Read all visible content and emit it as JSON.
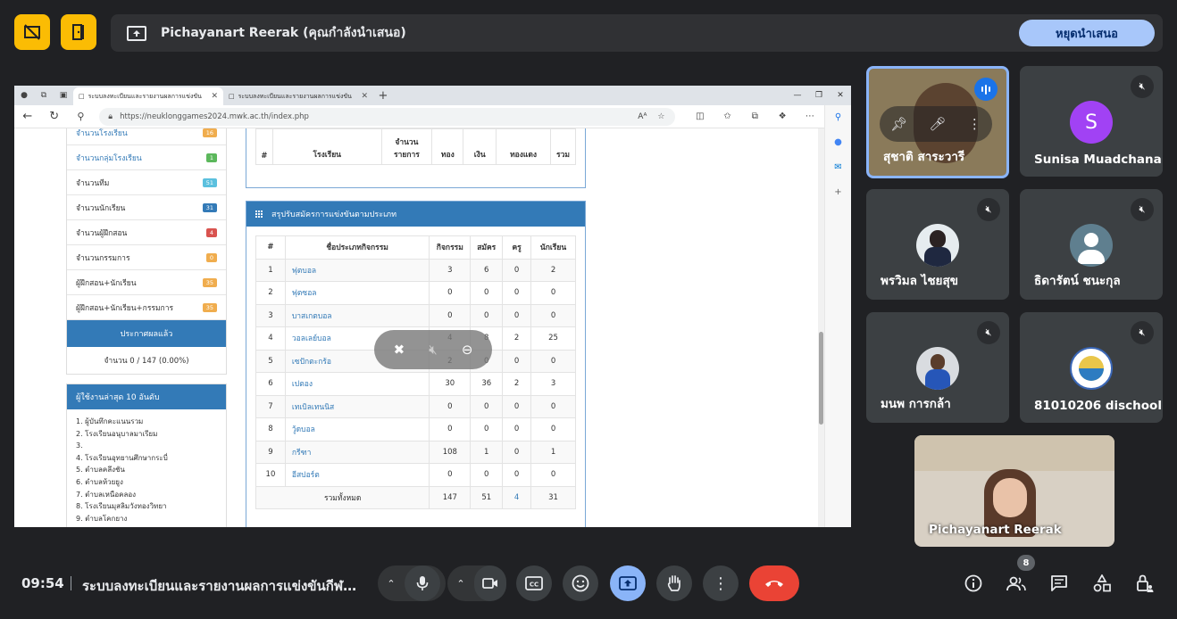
{
  "banner": {
    "presenter_title": "Pichayanart Reerak (คุณกำลังนำเสนอ)",
    "stop_label": "หยุดนำเสนอ"
  },
  "browser": {
    "tabs": [
      {
        "label": "ระบบลงทะเบียนและรายงานผลการแข่งขัน",
        "active": true
      },
      {
        "label": "ระบบลงทะเบียนและรายงานผลการแข่งขัน",
        "active": false
      }
    ],
    "url": "https://neuklonggames2024.mwk.ac.th/index.php",
    "reader_icon": "Aᴬ"
  },
  "left_panel": {
    "items": [
      {
        "label": "จำนวนโรงเรียน",
        "badge": "16",
        "color": "#f0ad4e",
        "link": true
      },
      {
        "label": "จำนวนกลุ่มโรงเรียน",
        "badge": "1",
        "color": "#5cb85c",
        "link": true
      },
      {
        "label": "จำนวนทีม",
        "badge": "51",
        "color": "#5bc0de",
        "link": false
      },
      {
        "label": "จำนวนนักเรียน",
        "badge": "31",
        "color": "#337ab7",
        "link": false
      },
      {
        "label": "จำนวนผู้ฝึกสอน",
        "badge": "4",
        "color": "#d9534f",
        "link": false
      },
      {
        "label": "จำนวนกรรมการ",
        "badge": "0",
        "color": "#f0ad4e",
        "link": false
      },
      {
        "label": "ผู้ฝึกสอน+นักเรียน",
        "badge": "35",
        "color": "#f0ad4e",
        "link": false
      },
      {
        "label": "ผู้ฝึกสอน+นักเรียน+กรรมการ",
        "badge": "35",
        "color": "#f0ad4e",
        "link": false
      }
    ],
    "announce": "ประกาศผลแล้ว",
    "count_text": "จำนวน 0 / 147 (0.00%)",
    "recent_title": "ผู้ใช้งานล่าสุด 10 อันดับ",
    "recent": [
      "1. ผู้บันทึกคะแนนรวม",
      "2. โรงเรียนอนุบาลมาเรียม",
      "3.",
      "4. โรงเรียนอุทยานศึกษากระบี่",
      "5. ตำบลคลึงชัน",
      "6. ตำบลห้วยยูง",
      "7. ตำบลเหนือคลอง",
      "8. โรงเรียนมุสลิมวังทองวิทยา",
      "9. ตำบลโคกยาง"
    ]
  },
  "medal_table": {
    "headers": [
      "#",
      "โรงเรียน",
      "จำนวน\nรายการ",
      "ทอง",
      "เงิน",
      "ทองแดง",
      "รวม"
    ]
  },
  "summary": {
    "title": "สรุปรับสมัครการแข่งขันตามประเภท",
    "headers": [
      "#",
      "ชื่อประเภทกิจกรรม",
      "กิจกรรม",
      "สมัคร",
      "ครู",
      "นักเรียน"
    ],
    "rows": [
      [
        "1",
        "ฟุตบอล",
        "3",
        "6",
        "0",
        "2"
      ],
      [
        "2",
        "ฟุตซอล",
        "0",
        "0",
        "0",
        "0"
      ],
      [
        "3",
        "บาสเกตบอล",
        "0",
        "0",
        "0",
        "0"
      ],
      [
        "4",
        "วอลเลย์บอล",
        "4",
        "8",
        "2",
        "25"
      ],
      [
        "5",
        "เซปักตะกร้อ",
        "2",
        "0",
        "0",
        "0"
      ],
      [
        "6",
        "เปตอง",
        "30",
        "36",
        "2",
        "3"
      ],
      [
        "7",
        "เทเบิลเทนนิส",
        "0",
        "0",
        "0",
        "0"
      ],
      [
        "8",
        "วู้ดบอล",
        "0",
        "0",
        "0",
        "0"
      ],
      [
        "9",
        "กรีฑา",
        "108",
        "1",
        "0",
        "1"
      ],
      [
        "10",
        "อีสปอร์ต",
        "0",
        "0",
        "0",
        "0"
      ]
    ],
    "total": [
      "รวมทั้งหมด",
      "147",
      "51",
      "4",
      "31"
    ]
  },
  "participants": [
    {
      "name": "สุชาติ สาระวารี",
      "speaking": true
    },
    {
      "name": "Sunisa Muadchana",
      "initial": "S",
      "avatar_color": "#a142f4"
    },
    {
      "name": "พรวิมล ไชยสุข"
    },
    {
      "name": "ธิดารัตน์ ชนะกุล"
    },
    {
      "name": "มนพ การกล้า"
    },
    {
      "name": "81010206 dischool"
    },
    {
      "name": "Pichayanart Reerak"
    }
  ],
  "bottom": {
    "time": "09:54",
    "meeting_title": "ระบบลงทะเบียนและรายงานผลการแข่งขันกีฬา…",
    "people_count": "8"
  }
}
